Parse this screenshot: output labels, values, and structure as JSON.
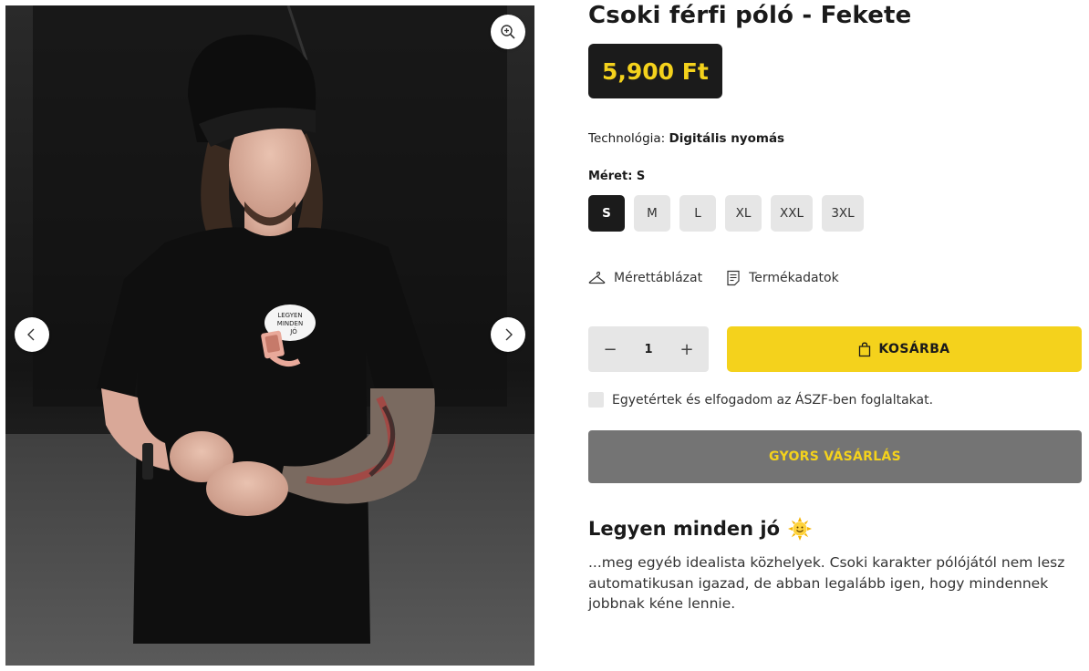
{
  "gallery": {
    "image_alt": "Csoki férfi póló - Fekete",
    "print_text": [
      "LEGYEN",
      "MINDEN",
      "JÓ"
    ]
  },
  "product": {
    "title": "Csoki férfi póló - Fekete",
    "price": "5,900 Ft",
    "technology_label": "Technológia:",
    "technology_value": "Digitális nyomás",
    "size_label": "Méret: S",
    "sizes": [
      "S",
      "M",
      "L",
      "XL",
      "XXL",
      "3XL"
    ],
    "selected_size": "S",
    "size_chart_label": "Mérettáblázat",
    "product_data_label": "Termékadatok",
    "quantity": "1",
    "qty_minus": "−",
    "qty_plus": "+",
    "cart_label": "KOSÁRBA",
    "agree_text": "Egyetértek és elfogadom az ÁSZF-ben foglaltakat.",
    "quick_buy_label": "GYORS VÁSÁRLÁS",
    "description_title": "Legyen minden jó",
    "description_text": "...meg egyéb idealista közhelyek. Csoki karakter pólójától nem lesz automatikusan igazad, de abban legalább igen, hogy mindennek jobbnak kéne lennie."
  },
  "colors": {
    "accent_yellow": "#f4d21c",
    "dark": "#1b1b1b",
    "chip_grey": "#e6e6e6",
    "quick_buy_grey": "#747474"
  },
  "icons": [
    "zoom-icon",
    "chevron-left-icon",
    "chevron-right-icon",
    "hanger-icon",
    "document-icon",
    "shopping-bag-icon",
    "sun-emoji-icon"
  ]
}
